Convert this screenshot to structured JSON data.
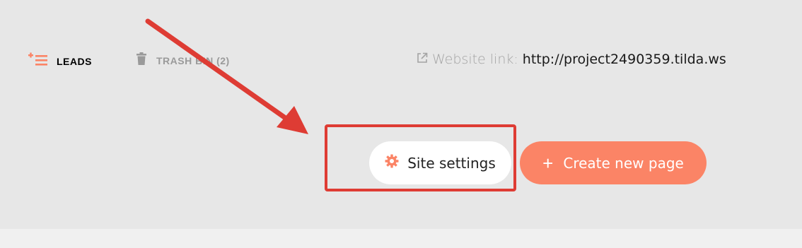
{
  "nav": {
    "leads": {
      "label": "LEADS",
      "icon": "leads-list-icon"
    },
    "trash": {
      "label": "TRASH BIN (2)",
      "icon": "trash-icon"
    }
  },
  "website": {
    "prefix": "Website link:",
    "url": "http://project2490359.tilda.ws",
    "icon": "external-link-icon"
  },
  "actions": {
    "site_settings": {
      "label": "Site settings",
      "icon": "gear-icon"
    },
    "create_page": {
      "label": "Create new page",
      "icon": "plus-icon"
    }
  },
  "colors": {
    "accent": "#fb8466",
    "annotation": "#de3c34",
    "background": "#e7e7e7"
  }
}
